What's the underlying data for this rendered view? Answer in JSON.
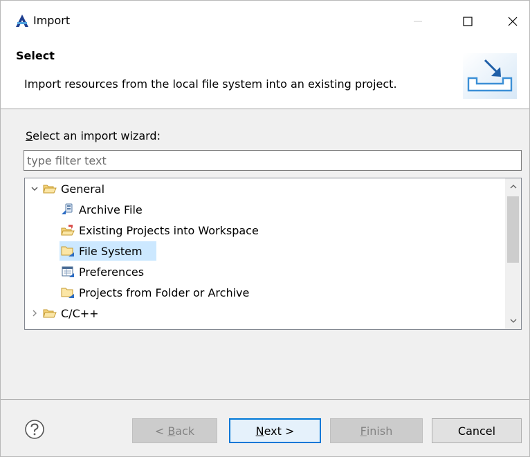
{
  "window": {
    "title": "Import"
  },
  "header": {
    "title": "Select",
    "description": "Import resources from the local file system into an existing project."
  },
  "wizard": {
    "label_mnemonic": "S",
    "label_rest": "elect an import wizard:",
    "filter_placeholder": "type filter text"
  },
  "tree": {
    "items": [
      {
        "label": "General",
        "icon": "folder-open-icon",
        "expanded": true,
        "level": 0
      },
      {
        "label": "Archive File",
        "icon": "archive-file-icon",
        "level": 1
      },
      {
        "label": "Existing Projects into Workspace",
        "icon": "existing-projects-icon",
        "level": 1
      },
      {
        "label": "File System",
        "icon": "file-system-folder-icon",
        "level": 1,
        "selected": true
      },
      {
        "label": "Preferences",
        "icon": "preferences-icon",
        "level": 1
      },
      {
        "label": "Projects from Folder or Archive",
        "icon": "projects-folder-icon",
        "level": 1
      },
      {
        "label": "C/C++",
        "icon": "folder-open-icon",
        "expanded": false,
        "level": 0
      }
    ]
  },
  "buttons": {
    "back_prefix": "< ",
    "back_mnemonic": "B",
    "back_rest": "ack",
    "next_mnemonic": "N",
    "next_rest": "ext >",
    "finish_mnemonic": "F",
    "finish_rest": "inish",
    "cancel": "Cancel"
  },
  "colors": {
    "selection": "#cce8ff",
    "default_button_border": "#0078d7",
    "app_icon": "#1f3f8f"
  }
}
